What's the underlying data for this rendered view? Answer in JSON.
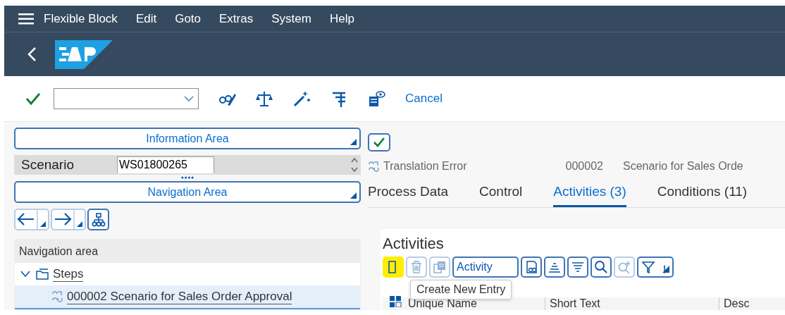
{
  "menu_bar": {
    "items": [
      "Flexible Block",
      "Edit",
      "Goto",
      "Extras",
      "System",
      "Help"
    ]
  },
  "toolbar": {
    "buttons": [
      {
        "kind": "display"
      },
      {
        "kind": "scale"
      },
      {
        "kind": "wizard"
      },
      {
        "kind": "filter"
      },
      {
        "kind": "viewer"
      }
    ],
    "cancel": "Cancel"
  },
  "left_panel": {
    "information_area": "Information Area",
    "scenario": {
      "label": "Scenario",
      "value": "WS01800265"
    },
    "navigation_area": "Navigation Area",
    "tree": {
      "header": "Navigation area",
      "items": [
        {
          "label": "Steps",
          "expanded": true,
          "selected": false,
          "children": [
            {
              "label": "000002 Scenario for Sales Order Approval",
              "selected": true
            }
          ]
        }
      ]
    }
  },
  "right_panel": {
    "step": {
      "type": "Translation Error",
      "number": "000002",
      "description": "Scenario for Sales Orde"
    },
    "tabs": [
      {
        "label": "Process Data",
        "selected": false
      },
      {
        "label": "Control",
        "selected": false
      },
      {
        "label": "Activities (3)",
        "selected": true
      },
      {
        "label": "Conditions (11)",
        "selected": false
      }
    ],
    "activities": {
      "title": "Activities",
      "toolbar": [
        {
          "kind": "create",
          "highlighted": true,
          "disabled": false
        },
        {
          "kind": "delete",
          "highlighted": false,
          "disabled": true
        },
        {
          "kind": "copy",
          "highlighted": false,
          "disabled": true
        },
        {
          "kind": "dropdown",
          "label": "Activity",
          "highlighted": false,
          "disabled": false
        },
        {
          "kind": "details",
          "highlighted": false,
          "disabled": false
        },
        {
          "kind": "sort-asc",
          "highlighted": false,
          "disabled": false
        },
        {
          "kind": "sort-desc",
          "highlighted": false,
          "disabled": false
        },
        {
          "kind": "find",
          "highlighted": false,
          "disabled": false
        },
        {
          "kind": "find-next",
          "highlighted": false,
          "disabled": true
        },
        {
          "kind": "filter",
          "highlighted": false,
          "disabled": false
        }
      ],
      "tooltip": "Create New Entry",
      "columns": [
        "Unique Name",
        "Short Text",
        "Desc"
      ]
    }
  }
}
